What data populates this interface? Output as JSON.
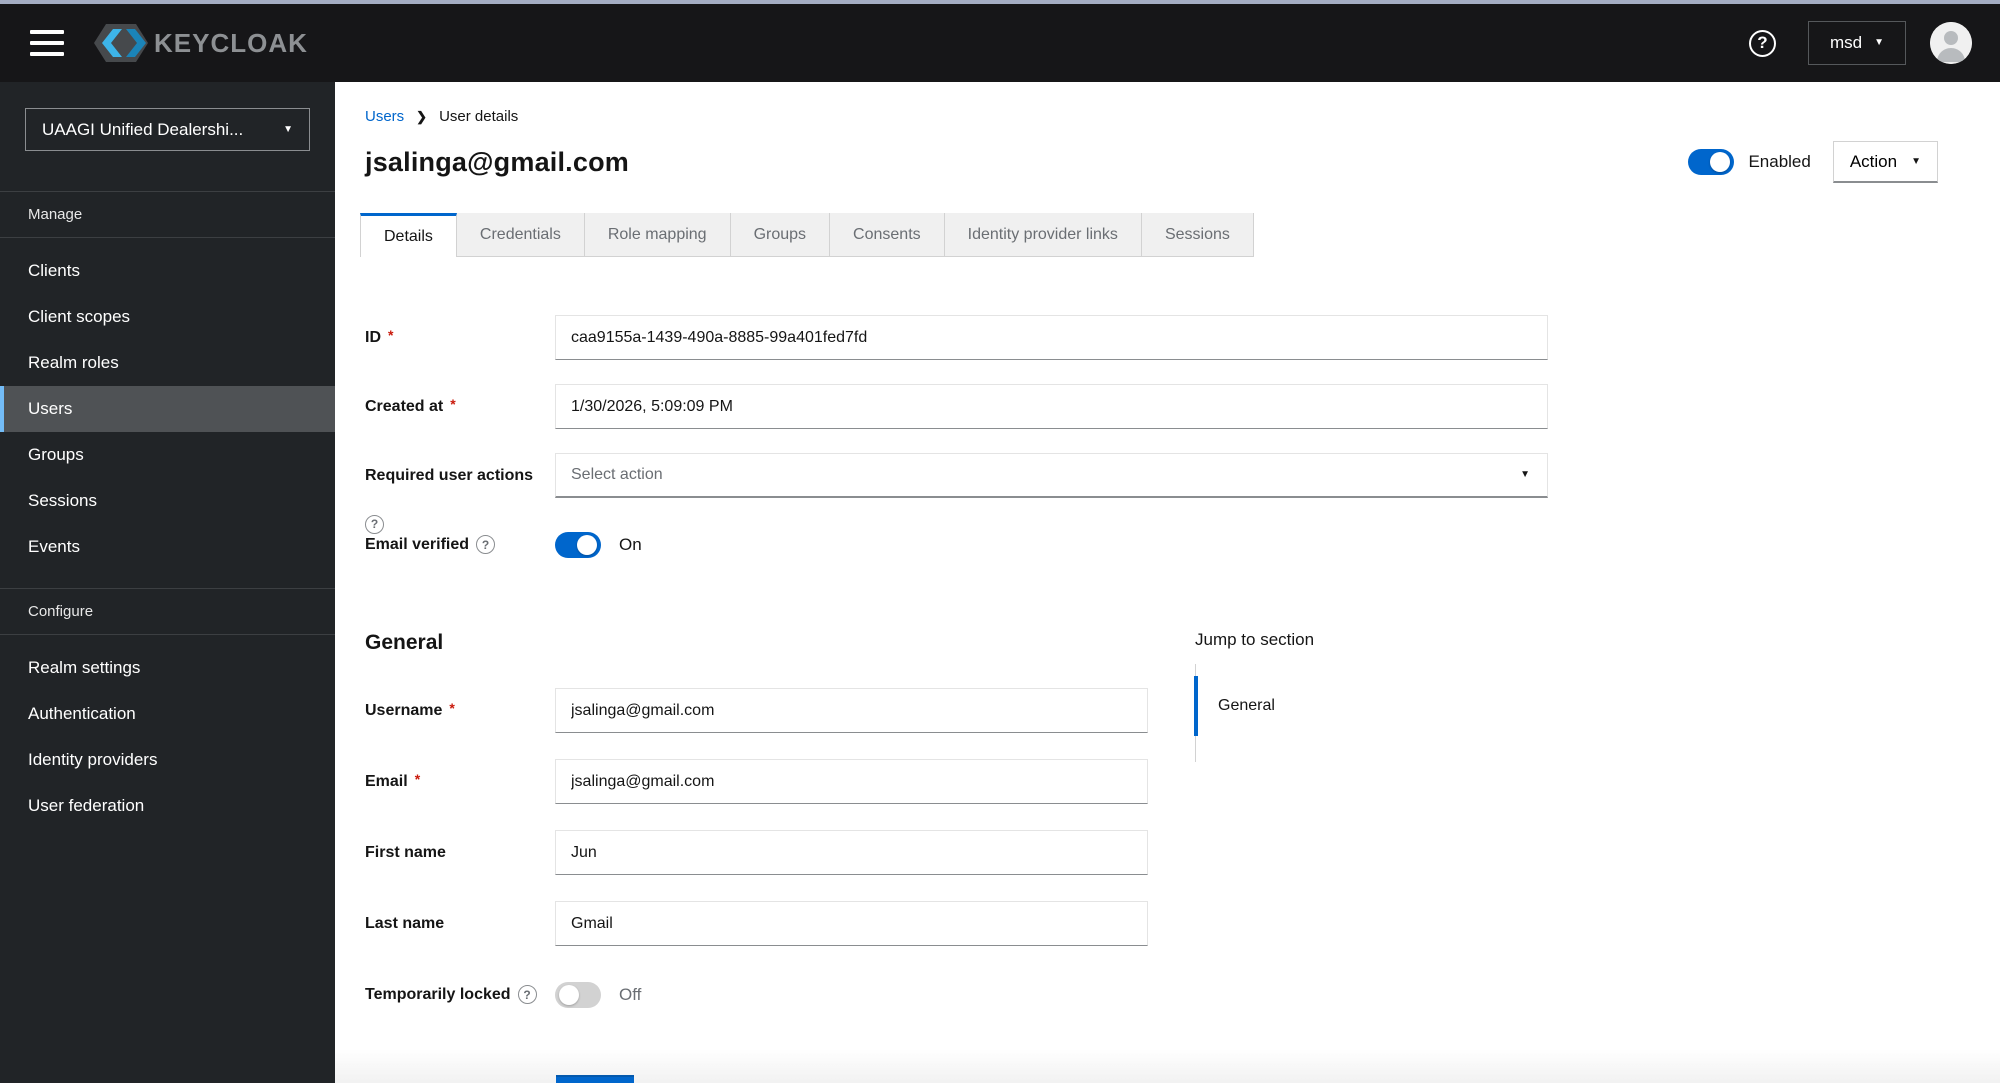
{
  "topbar": {
    "brand": "KEYCLOAK",
    "user_menu": "msd"
  },
  "icons": {
    "help": "?",
    "caret_down": "▼",
    "breadcrumb_chevron": "❯",
    "required_marker": "*"
  },
  "sidebar": {
    "realm_selector": "UAAGI Unified Dealershi...",
    "active_item": "Users",
    "sections": [
      {
        "label": "Manage",
        "items": [
          "Clients",
          "Client scopes",
          "Realm roles",
          "Users",
          "Groups",
          "Sessions",
          "Events"
        ]
      },
      {
        "label": "Configure",
        "items": [
          "Realm settings",
          "Authentication",
          "Identity providers",
          "User federation"
        ]
      }
    ]
  },
  "breadcrumb": {
    "link": "Users",
    "current": "User details"
  },
  "header": {
    "title": "jsalinga@gmail.com",
    "enabled_label": "Enabled",
    "enabled_state": "on",
    "action_label": "Action"
  },
  "tabs": {
    "active": "Details",
    "items": [
      "Details",
      "Credentials",
      "Role mapping",
      "Groups",
      "Consents",
      "Identity provider links",
      "Sessions"
    ]
  },
  "form": {
    "id": {
      "label": "ID",
      "value": "caa9155a-1439-490a-8885-99a401fed7fd"
    },
    "created_at": {
      "label": "Created at",
      "value": "1/30/2026, 5:09:09 PM"
    },
    "required_user_actions": {
      "label": "Required user actions",
      "placeholder": "Select action"
    },
    "email_verified": {
      "label": "Email verified",
      "state": "On"
    },
    "general_heading": "General",
    "username": {
      "label": "Username",
      "value": "jsalinga@gmail.com"
    },
    "email": {
      "label": "Email",
      "value": "jsalinga@gmail.com"
    },
    "first_name": {
      "label": "First name",
      "value": "Jun"
    },
    "last_name": {
      "label": "Last name",
      "value": "Gmail"
    },
    "temporarily_locked": {
      "label": "Temporarily locked",
      "state": "Off"
    }
  },
  "jump_to_section": {
    "heading": "Jump to section",
    "items": [
      "General"
    ],
    "active": "General"
  },
  "colors": {
    "primary": "#0066cc",
    "link": "#0066cc",
    "danger": "#c9190b",
    "topbar_bg": "#161618",
    "top_strip": "#a4adc2",
    "sidebar_bg": "#212427",
    "nav_selected_bg": "#4f5255",
    "nav_selected_border": "#73bcf7",
    "tab_inactive_bg": "#f0f0f0",
    "muted_text": "#6a6e73"
  }
}
